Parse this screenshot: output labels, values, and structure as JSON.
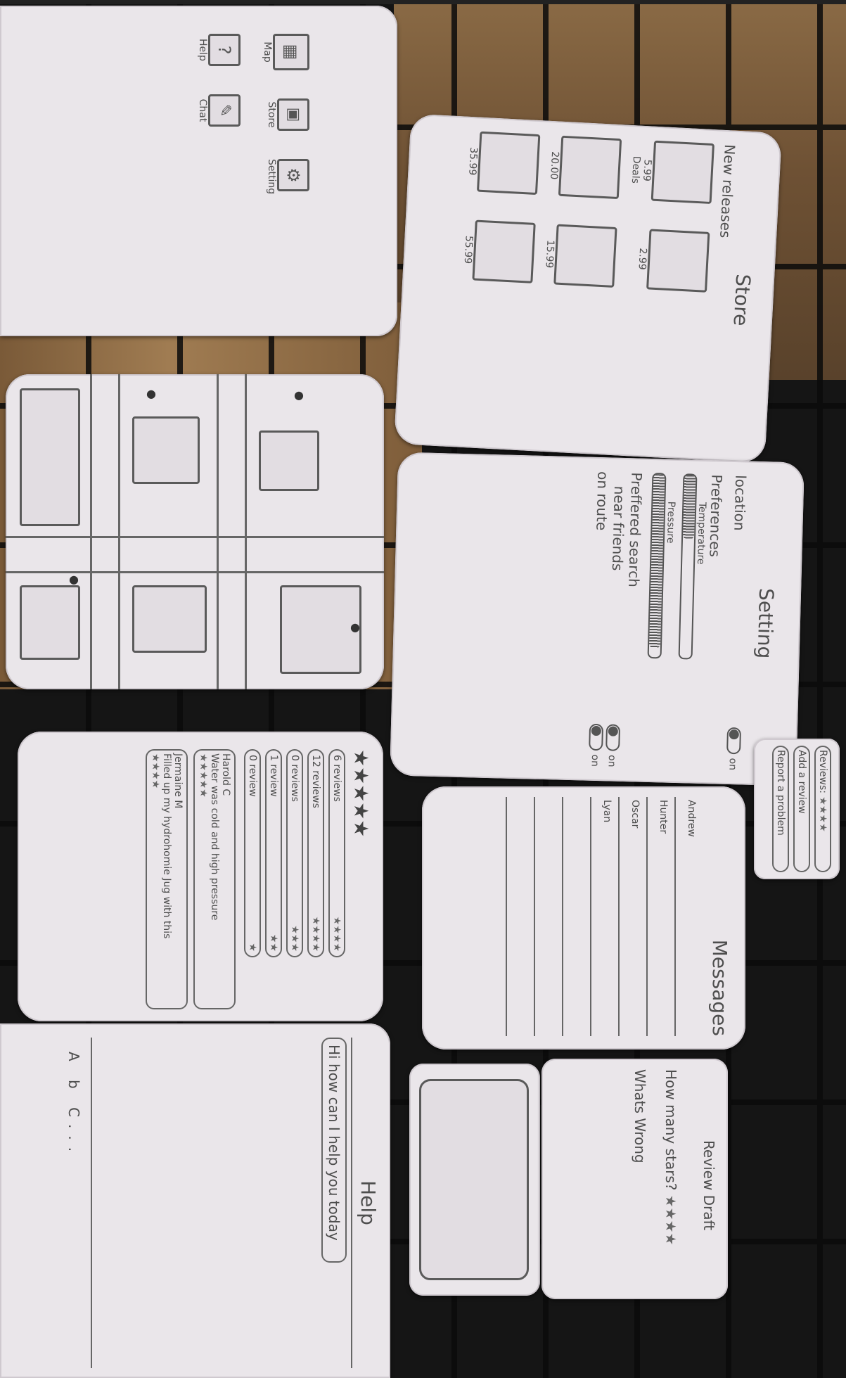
{
  "home": {
    "icons": [
      {
        "label": "Map",
        "icon": "map-icon"
      },
      {
        "label": "Help",
        "icon": "help-icon"
      },
      {
        "label": "Store",
        "icon": "store-icon"
      },
      {
        "label": "Chat",
        "icon": "chat-icon"
      },
      {
        "label": "Setting",
        "icon": "gear-icon"
      }
    ]
  },
  "store": {
    "title": "Store",
    "new_releases": "New releases",
    "deals": "Deals",
    "prices": [
      "5.99",
      "2.99",
      "20.00",
      "15.99",
      "35.99",
      "55.99"
    ]
  },
  "setting": {
    "title": "Setting",
    "location": "location",
    "location_toggle": "on",
    "preferences": "Preferences",
    "temperature": "Temperature",
    "temperature_level": 0.35,
    "pressure": "Pressure",
    "pressure_level": 0.95,
    "preferred_search": "Preffered search",
    "near_friends": "near friends",
    "near_friends_toggle": "on",
    "on_route": "on route",
    "on_route_toggle": "on"
  },
  "reviews": {
    "rows": [
      {
        "count": "6 reviews",
        "stars": "★★★★"
      },
      {
        "count": "12 reviews",
        "stars": "★★★★"
      },
      {
        "count": "0 reviews",
        "stars": "★★★"
      },
      {
        "count": "1 review",
        "stars": "★★"
      },
      {
        "count": "0 review",
        "stars": "★"
      }
    ],
    "stars_header": "★★★★★",
    "comments": [
      {
        "author": "Harold C",
        "text": "Water was cold and high pressure",
        "stars": "★★★★★"
      },
      {
        "author": "Jermaine M",
        "text": "Filled up my hydrohomie Jug with this",
        "stars": "★★★★"
      }
    ]
  },
  "messages": {
    "title": "Messages",
    "contacts": [
      "Andrew",
      "Hunter",
      "Oscar",
      "Lyan"
    ]
  },
  "review_popup": {
    "stars_label": "Reviews",
    "stars": "★★★★",
    "add_review": "Add a review",
    "report": "Report a problem"
  },
  "help": {
    "title": "Help",
    "bubble": "Hi how can I help you today",
    "typing": "A b C..."
  },
  "review_draft": {
    "title": "Review Draft",
    "how_many": "How many stars?",
    "stars": "★★★★",
    "whats_wrong": "Whats Wrong"
  }
}
